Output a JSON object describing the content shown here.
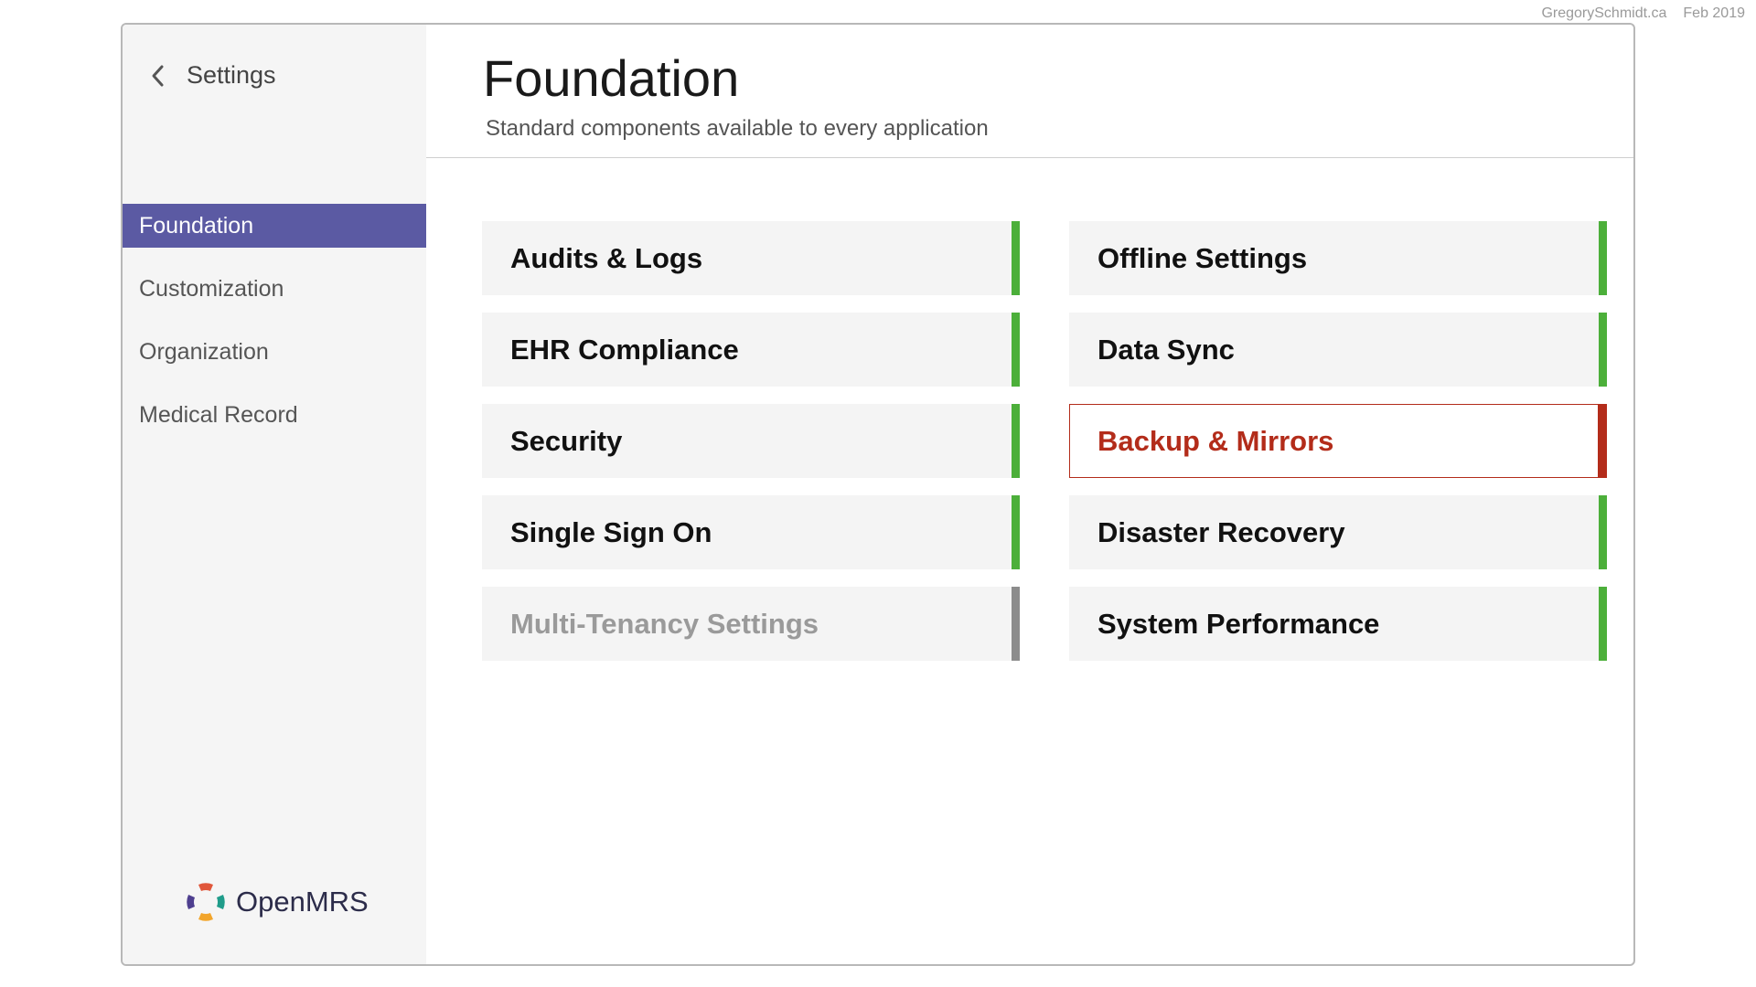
{
  "credits": {
    "site": "GregorySchmidt.ca",
    "date": "Feb 2019"
  },
  "sidebar": {
    "back_label": "Settings",
    "items": [
      {
        "label": "Foundation",
        "active": true
      },
      {
        "label": "Customization",
        "active": false
      },
      {
        "label": "Organization",
        "active": false
      },
      {
        "label": "Medical Record",
        "active": false
      }
    ],
    "logo_text": "OpenMRS"
  },
  "header": {
    "title": "Foundation",
    "subtitle": "Standard components available to every application"
  },
  "cards": [
    {
      "label": "Audits & Logs",
      "state": "enabled"
    },
    {
      "label": "Offline Settings",
      "state": "enabled"
    },
    {
      "label": "EHR Compliance",
      "state": "enabled"
    },
    {
      "label": "Data Sync",
      "state": "enabled"
    },
    {
      "label": "Security",
      "state": "enabled"
    },
    {
      "label": "Backup & Mirrors",
      "state": "selected"
    },
    {
      "label": "Single Sign On",
      "state": "enabled"
    },
    {
      "label": "Disaster Recovery",
      "state": "enabled"
    },
    {
      "label": "Multi-Tenancy Settings",
      "state": "disabled"
    },
    {
      "label": "System Performance",
      "state": "enabled"
    }
  ],
  "colors": {
    "accent": "#5b5aa3",
    "enabled": "#4caf3a",
    "disabled": "#8c8c8c",
    "selected": "#b32c1a"
  },
  "icons": {
    "back": "chevron-left-icon",
    "logo": "openmrs-logo-icon"
  }
}
